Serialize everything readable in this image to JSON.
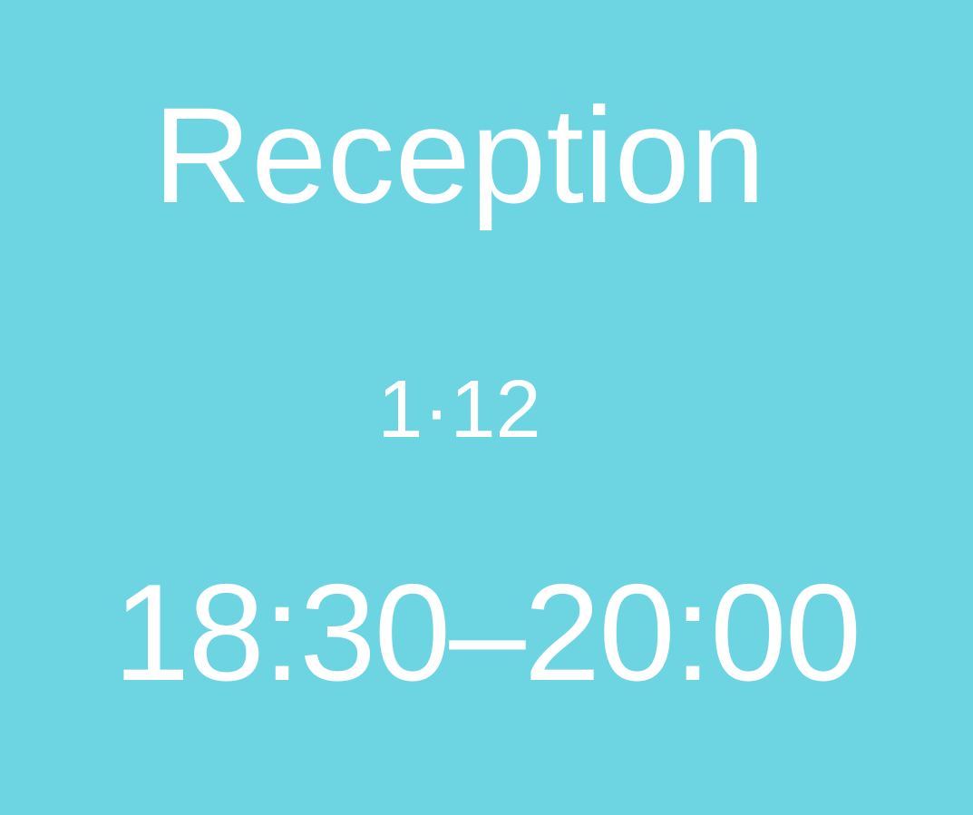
{
  "event": {
    "title": "Reception",
    "room": "1·12",
    "time": "18:30–20:00"
  },
  "colors": {
    "background": "#6dd5e1",
    "text": "#ffffff"
  }
}
